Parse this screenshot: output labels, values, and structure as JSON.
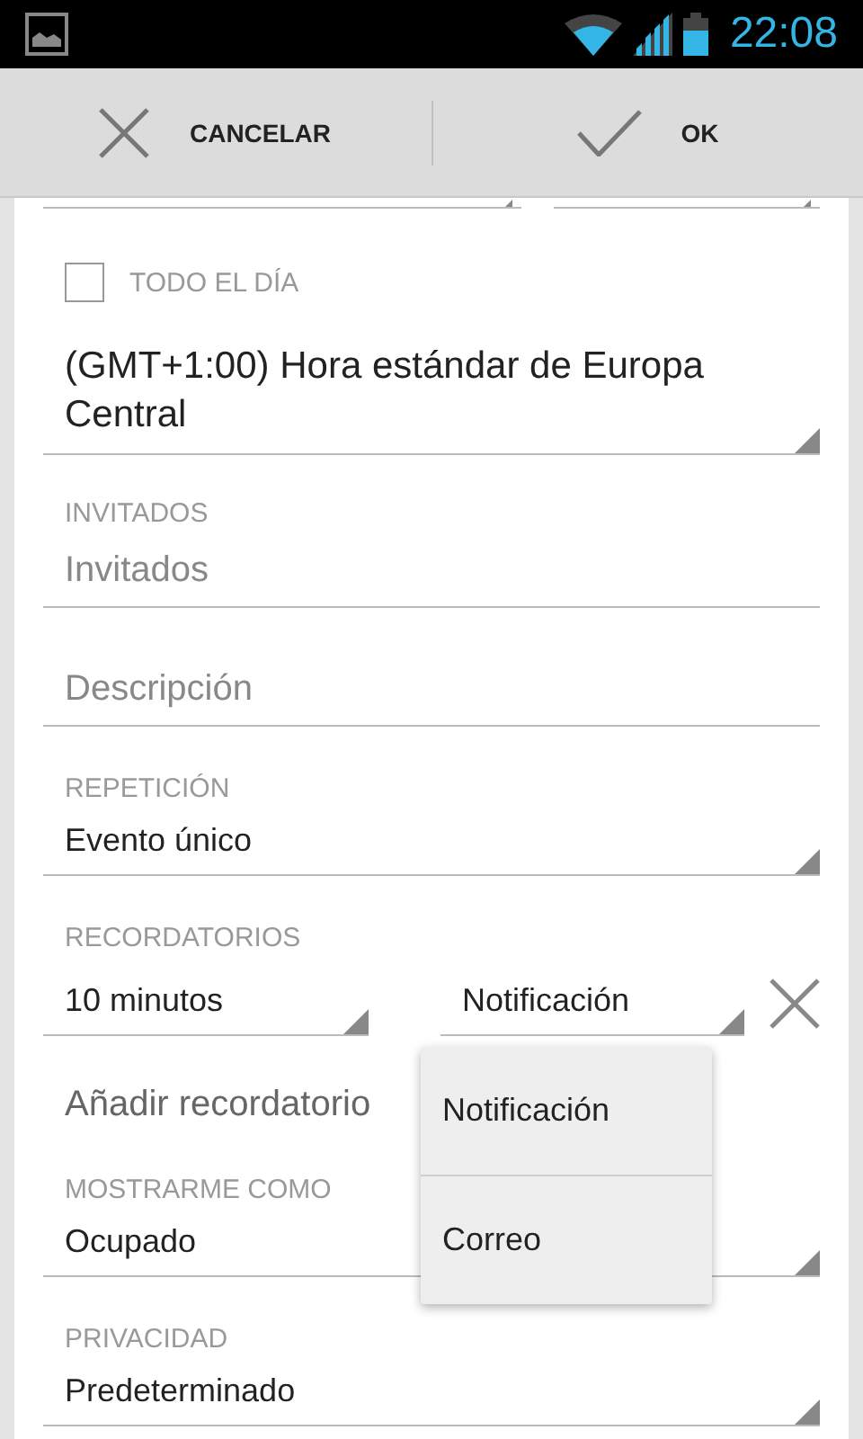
{
  "status_bar": {
    "time": "22:08"
  },
  "action_bar": {
    "buttons": [
      {
        "kind": "cancel",
        "label": "CANCELAR"
      },
      {
        "kind": "ok",
        "label": "OK"
      }
    ]
  },
  "all_day": {
    "label": "TODO EL DÍA",
    "checked": false
  },
  "timezone": {
    "value": "(GMT+1:00) Hora estándar de Europa Central"
  },
  "guests": {
    "label": "INVITADOS",
    "placeholder": "Invitados"
  },
  "description": {
    "placeholder": "Descripción"
  },
  "repetition": {
    "label": "REPETICIÓN",
    "value": "Evento único"
  },
  "reminders": {
    "label": "RECORDATORIOS",
    "items": [
      {
        "time": "10 minutos",
        "method": "Notificación"
      }
    ],
    "add_label": "Añadir recordatorio"
  },
  "show_as": {
    "label": "MOSTRARME COMO",
    "value": "Ocupado"
  },
  "privacy": {
    "label": "PRIVACIDAD",
    "value": "Predeterminado"
  },
  "dropdown": {
    "options": [
      {
        "label": "Notificación"
      },
      {
        "label": "Correo"
      }
    ]
  }
}
